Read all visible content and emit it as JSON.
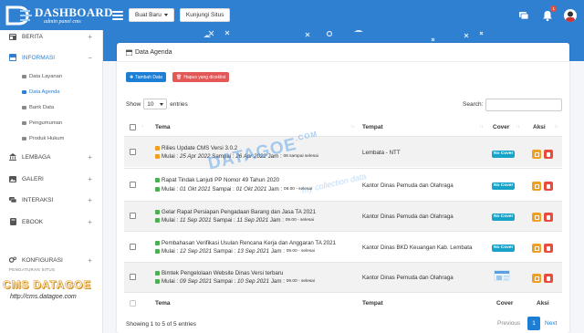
{
  "brand": {
    "title": "DASHBOARD",
    "subtitle": "admin panel cms"
  },
  "header": {
    "new_button": "Buat Baru",
    "visit_button": "Kunjungi Situs",
    "notification_count": "1",
    "accent_color": "#2f80d1"
  },
  "sidebar": {
    "items": [
      {
        "label": "BERITA",
        "icon": "newspaper-icon",
        "toggle": "+"
      },
      {
        "label": "INFORMASI",
        "icon": "info-box-icon",
        "toggle": "−"
      },
      {
        "label": "LEMBAGA",
        "icon": "institution-icon",
        "toggle": "+"
      },
      {
        "label": "GALERI",
        "icon": "gallery-icon",
        "toggle": "+"
      },
      {
        "label": "INTERAKSI",
        "icon": "chat-icon",
        "toggle": "+"
      },
      {
        "label": "EBOOK",
        "icon": "book-icon",
        "toggle": "+"
      },
      {
        "label": "KONFIGURASI",
        "icon": "gears-icon",
        "toggle": "+"
      }
    ],
    "sub_items": [
      "Data Layanan",
      "Data Agenda",
      "Bank Data",
      "Pengumuman",
      "Produk Hukum"
    ],
    "section_label": "PENGATURAN SITUS",
    "watermark_title": "CMS DATAGOE",
    "watermark_url": "http://cms.datagoe.com"
  },
  "card": {
    "title": "Data Agenda",
    "add_button": "Tambah Data",
    "delete_button": "Hapus yang diceklist",
    "show_label": "Show",
    "entries_value": "10",
    "entries_label": "entries",
    "search_label": "Search:",
    "search_value": ""
  },
  "table": {
    "columns": [
      "Tema",
      "Tempat",
      "Cover",
      "Aksi"
    ],
    "rows": [
      {
        "title": "Rilies Update CMS Versi 3.0.2",
        "mulai_label": "Mulai :",
        "mulai": "25 Apr 2022",
        "sampai_label": "Sampai :",
        "sampai": "26 Apr 2022",
        "jam_label": "Jam :",
        "jam": "08 sampai selesai",
        "tempat": "Lembata - NTT",
        "cover": "No Cover",
        "status_color": "#f0a020"
      },
      {
        "title": "Rapat Tindak Lanjuti PP Nomor 49 Tahun 2020",
        "mulai_label": "Mulai :",
        "mulai": "01 Okt 2021",
        "sampai_label": "Sampai :",
        "sampai": "01 Okt 2021",
        "jam_label": "Jam :",
        "jam": "08.00 - selesai",
        "tempat": "Kantor Dinas Pemuda dan Olahraga",
        "cover": "No Cover",
        "status_color": "#4caf50"
      },
      {
        "title": "Gelar Rapat Persiapan Pengadaan Barang dan Jasa TA 2021",
        "mulai_label": "Mulai :",
        "mulai": "11 Sep 2021",
        "sampai_label": "Sampai :",
        "sampai": "11 Sep 2021",
        "jam_label": "Jam :",
        "jam": "09.00 - selesai",
        "tempat": "Kantor Dinas Pemuda dan Olahraga",
        "cover": "No Cover",
        "status_color": "#4caf50"
      },
      {
        "title": "Pembahasan Verifikasi Usulan Rencana Kerja dan Anggaran TA 2021",
        "mulai_label": "Mulai :",
        "mulai": "12 Sep 2021",
        "sampai_label": "Sampai :",
        "sampai": "13 Sep 2021",
        "jam_label": "Jam :",
        "jam": "09.00 - selesai",
        "tempat": "Kantor Dinas BKD Keuangan Kab. Lembata",
        "cover": "No Cover",
        "status_color": "#4caf50"
      },
      {
        "title": "Bimtek Pengelolaan Website Dinas Versi terbaru",
        "mulai_label": "Mulai :",
        "mulai": "09 Sep 2021",
        "sampai_label": "Sampai :",
        "sampai": "10 Sep 2021",
        "jam_label": "Jam :",
        "jam": "09.00 - selesai",
        "tempat": "Kantor Dinas Pemuda dan Olahraga",
        "cover": "",
        "status_color": "#4caf50"
      }
    ]
  },
  "footer": {
    "info": "Showing 1 to 5 of 5 entries",
    "previous": "Previous",
    "page": "1",
    "next": "Next"
  },
  "overlay": {
    "watermark": "DATAGOE",
    "watermark_tld": ".COM",
    "watermark_sub": "my collection data"
  }
}
